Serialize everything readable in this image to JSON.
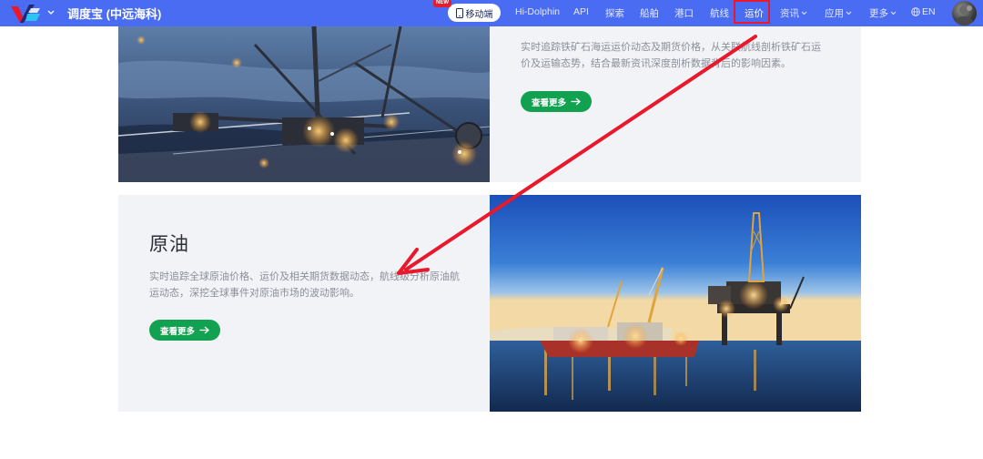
{
  "nav": {
    "brand": "调度宝 (中远海科)",
    "new_badge": "NEW",
    "mobile_label": "移动端",
    "items": [
      {
        "label": "Hi-Dolphin"
      },
      {
        "label": "API"
      },
      {
        "label": "探索"
      },
      {
        "label": "船舶"
      },
      {
        "label": "港口"
      },
      {
        "label": "航线"
      },
      {
        "label": "运价"
      },
      {
        "label": "资讯"
      },
      {
        "label": "应用"
      },
      {
        "label": "更多"
      }
    ],
    "lang": "EN",
    "accent_color": "#4a6cf2",
    "highlight_color": "#e8192c"
  },
  "cards": [
    {
      "title": "",
      "description": "实时追踪铁矿石海运运价动态及期货价格，从关联航线剖析铁矿石运价及运输态势，结合最新资讯深度剖析数据背后的影响因素。",
      "button_label": "查看更多",
      "image": "mining-excavator-at-night"
    },
    {
      "title": "原油",
      "description": "实时追踪全球原油价格、运价及相关期货数据动态，航线级分析原油航运动态，深挖全球事件对原油市场的波动影响。",
      "button_label": "查看更多",
      "image": "offshore-oil-rig-at-dusk"
    }
  ],
  "button_color": "#12a150"
}
